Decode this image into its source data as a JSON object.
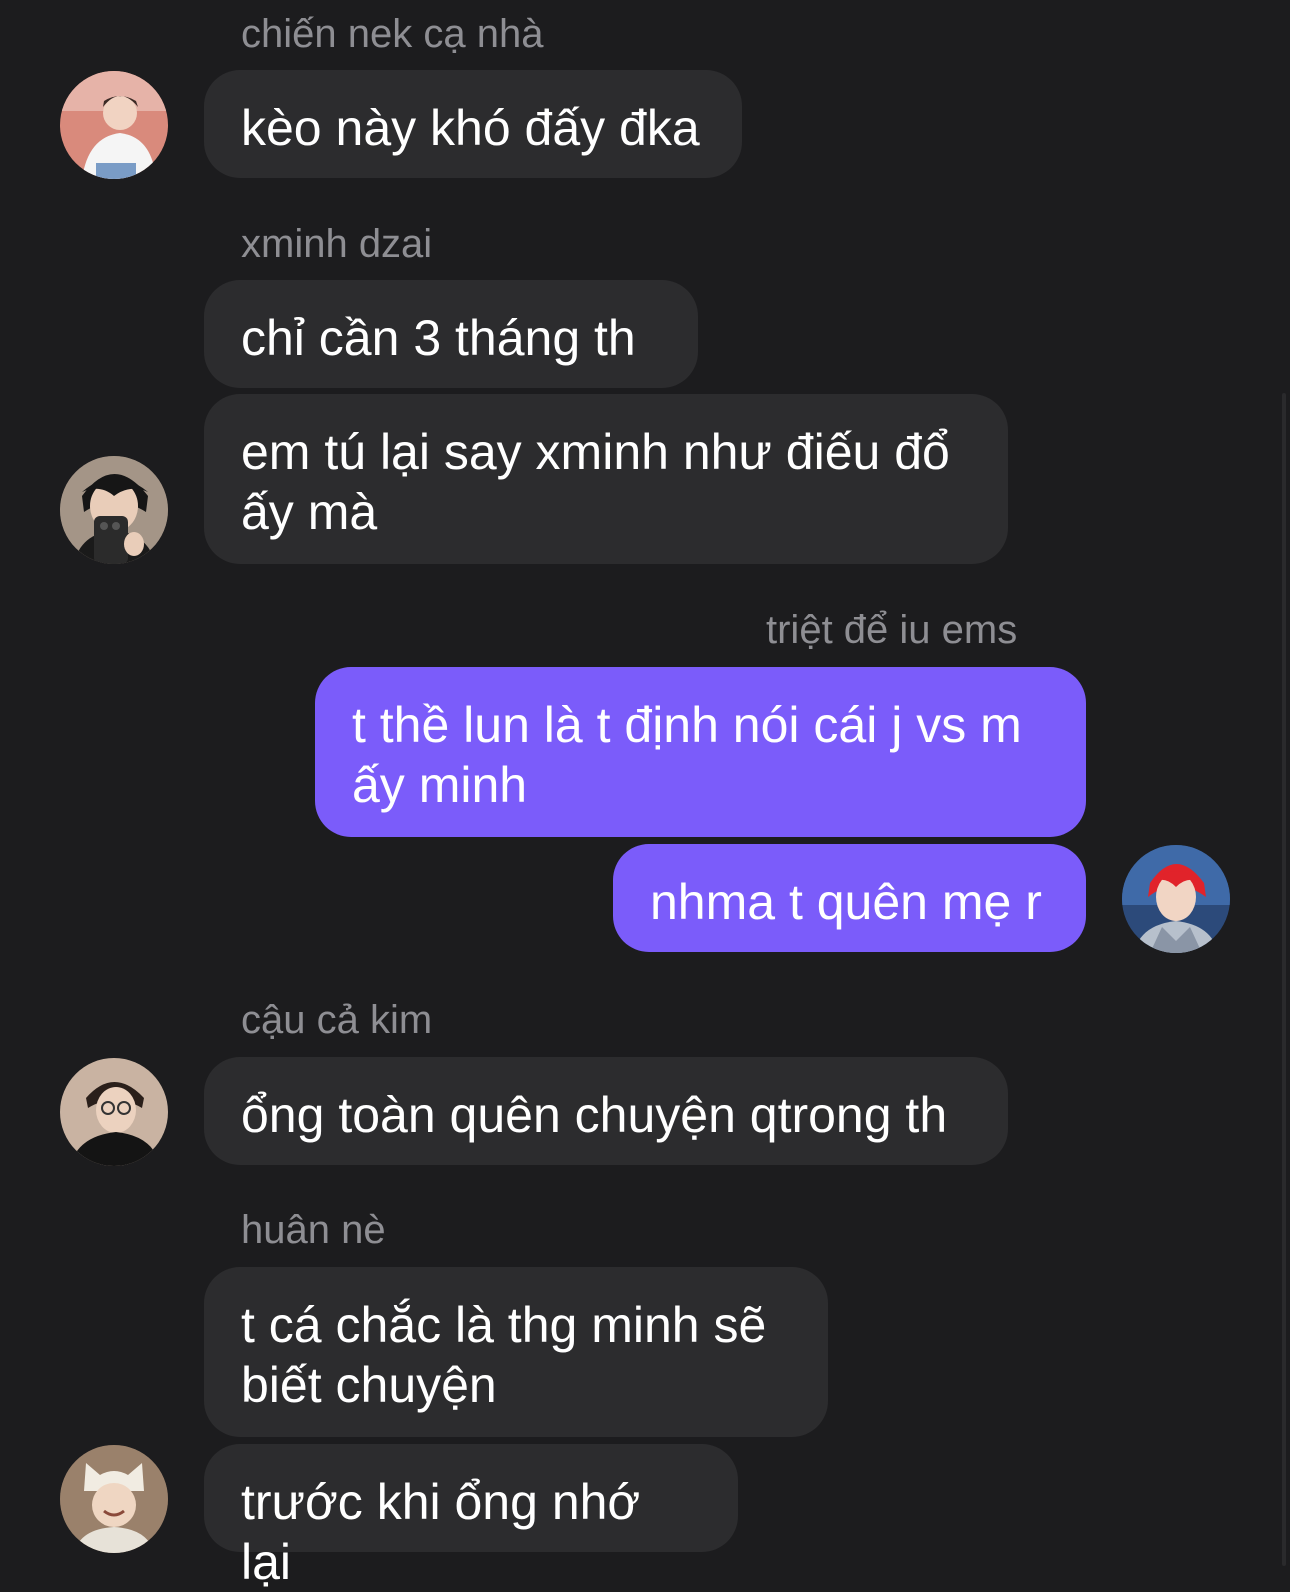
{
  "colors": {
    "background": "#1c1c1e",
    "incoming_bubble": "#2c2c2e",
    "outgoing_bubble": "#7b5cfa",
    "sender_name": "#8e8e93",
    "message_text": "#ffffff"
  },
  "messages": [
    {
      "sender": "chiến nek cạ nhà",
      "text": "kèo này khó đấy đka",
      "direction": "incoming"
    },
    {
      "sender": "xminh dzai",
      "text": "chỉ cần 3 tháng th",
      "direction": "incoming"
    },
    {
      "sender": "",
      "text": "em tú lại say xminh như điếu đổ ấy mà",
      "direction": "incoming"
    },
    {
      "sender": "triệt để iu ems",
      "text": "t thề lun là t định nói cái j vs m ấy minh",
      "direction": "outgoing"
    },
    {
      "sender": "",
      "text": "nhma t quên mẹ r",
      "direction": "outgoing"
    },
    {
      "sender": "cậu cả kim",
      "text": "ổng toàn quên chuyện qtrong th",
      "direction": "incoming"
    },
    {
      "sender": "huân nè",
      "text": "t cá chắc là thg minh sẽ biết chuyện",
      "direction": "incoming"
    },
    {
      "sender": "",
      "text": "trước khi ổng nhớ lại",
      "direction": "incoming"
    }
  ],
  "avatars": [
    {
      "name": "avatar-chien",
      "icon": "profile-photo"
    },
    {
      "name": "avatar-xminh",
      "icon": "profile-photo"
    },
    {
      "name": "avatar-triet",
      "icon": "profile-photo"
    },
    {
      "name": "avatar-kim",
      "icon": "profile-photo"
    },
    {
      "name": "avatar-huan",
      "icon": "profile-photo"
    }
  ]
}
